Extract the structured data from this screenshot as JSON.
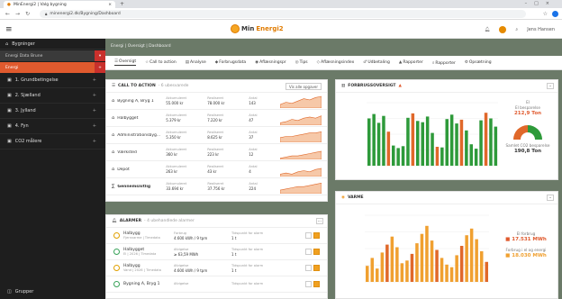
{
  "browser": {
    "tab_title": "MinEnergi2 | Valg bygning",
    "url": "minenergi2.dk/Bygning/Dashboard"
  },
  "app": {
    "logo_prefix": "Min",
    "logo_suffix": "Energi2",
    "user": "Jens Hansen"
  },
  "sidebar": {
    "title": "Bygninger",
    "select": "Energi Data Brune",
    "active": "Energi",
    "items": [
      {
        "label": "1. Grundbetingelse"
      },
      {
        "label": "2. Sjælland"
      },
      {
        "label": "3. Jylland"
      },
      {
        "label": "4. Fyn"
      },
      {
        "label": "CO2 målere"
      }
    ],
    "bottom": "Grupper"
  },
  "breadcrumb": "Energi | Oversigt | Dashboard",
  "toolbar": [
    {
      "label": "Oversigt",
      "icon": "☰"
    },
    {
      "label": "Call to action",
      "icon": "☆"
    },
    {
      "label": "Analyse",
      "icon": "▤"
    },
    {
      "label": "Forbrugsdata",
      "icon": "◆"
    },
    {
      "label": "Aflæsningspr",
      "icon": "◉"
    },
    {
      "label": "Tips",
      "icon": "◎"
    },
    {
      "label": "Aflæsningsindex",
      "icon": "◇"
    },
    {
      "label": "Udbetaling",
      "icon": "♂"
    },
    {
      "label": "Rapporter",
      "icon": "▲"
    },
    {
      "label": "Rapporter",
      "icon": "⌕"
    },
    {
      "label": "Opsætning",
      "icon": "⚙"
    }
  ],
  "cta": {
    "title": "CALL TO ACTION",
    "subtitle": "- 6 ubesvarede",
    "button": "Vis alle opgaver",
    "rows": [
      {
        "name": "Bygning A, Bryg 1",
        "c1l": "Akkumuleret",
        "c1v": "55.000 kr",
        "c2l": "Realiseret",
        "c2v": "78.000 kr",
        "c3l": "Antal",
        "c3v": "143"
      },
      {
        "name": "Halbygget",
        "c1l": "Akkumuleret",
        "c1v": "5.379 kr",
        "c2l": "Realiseret",
        "c2v": "7.220 kr",
        "c3l": "Antal",
        "c3v": "47"
      },
      {
        "name": "Administrationsbyg...",
        "c1l": "Akkumuleret",
        "c1v": "5.350 kr",
        "c2l": "Realiseret",
        "c2v": "8.625 kr",
        "c3l": "Antal",
        "c3v": "37"
      },
      {
        "name": "Værksted",
        "c1l": "Akkumuleret",
        "c1v": "360 kr",
        "c2l": "Realiseret",
        "c2v": "223 kr",
        "c3l": "Antal",
        "c3v": "12"
      },
      {
        "name": "Depot",
        "c1l": "Akkumuleret",
        "c1v": "263 kr",
        "c2l": "Realiseret",
        "c2v": "43 kr",
        "c3l": "Antal",
        "c3v": "4"
      }
    ],
    "total": {
      "name": "Gennemsnitlig",
      "c1l": "Akkumuleret",
      "c1v": "33.694 kr",
      "c2l": "Realiseret",
      "c2v": "37.756 kr",
      "c3l": "Antal",
      "c3v": "224"
    }
  },
  "alarms": {
    "title": "ALARMER",
    "subtitle": "- 4 ubehandlede alarmer",
    "rows": [
      {
        "name": "Halbygg",
        "sub": "Fjernvarme | Timedata",
        "c1l": "Forbrug",
        "c1v": "4.600 kWh / 9 tpm",
        "c2l": "Tidspunkt for alarm",
        "c2v": "1 t"
      },
      {
        "name": "Halbygget",
        "sub": "El | 2026 | Timedata",
        "c1l": "Afvigelse",
        "c1v": "≥ 63,59 MWh",
        "c2l": "Tidspunkt for alarm",
        "c2v": "1 t"
      },
      {
        "name": "Halbygg",
        "sub": "Vand | 2026 | Timedata",
        "c1l": "Afvigelse",
        "c1v": "4.600 kWh / 9 tpm",
        "c2l": "Tidspunkt for alarm",
        "c2v": "1 t"
      },
      {
        "name": "Bygning A, Bryg 1",
        "sub": "",
        "c1l": "Afvigelse",
        "c1v": "",
        "c2l": "Tidspunkt for alarm",
        "c2v": ""
      }
    ]
  },
  "overview": {
    "title": "FORBRUGSOVERSIGT",
    "side_label": "El",
    "side_sub": "El besparelse",
    "side_value": "212,9 Ton",
    "donut_label": "Samlet CO2 besparelse",
    "donut_value": "190,8 Ton"
  },
  "heat": {
    "title": "VARME",
    "s1_label": "El forbrug",
    "s1_value": "17.531 MWh",
    "s2_label": "Forbrug i el og energi",
    "s2_value": "18.030 MWh"
  },
  "chart_data": [
    {
      "type": "bar",
      "title": "FORBRUGSOVERSIGT",
      "series": [
        {
          "values": [
            7.5,
            8.2,
            6.8,
            7.9,
            5.4,
            3.2,
            2.8,
            3.1,
            7.6,
            8.3,
            7.1,
            6.9,
            7.8,
            5.2,
            3.0,
            2.9,
            7.4,
            8.1,
            6.7,
            7.3,
            5.6,
            3.4,
            2.7,
            7.2,
            8.4,
            7.5,
            6.2
          ]
        }
      ],
      "color_primary": "#2e9a3a",
      "color_secondary": "#e0682a",
      "ylim": [
        0,
        10
      ]
    },
    {
      "type": "bar",
      "title": "VARME",
      "series": [
        {
          "values": [
            1.2,
            1.8,
            1.0,
            2.2,
            2.8,
            3.4,
            2.6,
            1.4,
            1.6,
            2.1,
            2.9,
            3.6,
            4.2,
            3.1,
            2.4,
            1.8,
            1.3,
            1.1,
            2.0,
            2.7,
            3.5,
            4.0,
            3.2,
            2.3,
            1.5
          ]
        }
      ],
      "color_primary": "#f0a030",
      "color_secondary": "#e0682a",
      "ylim": [
        0,
        5
      ]
    }
  ]
}
